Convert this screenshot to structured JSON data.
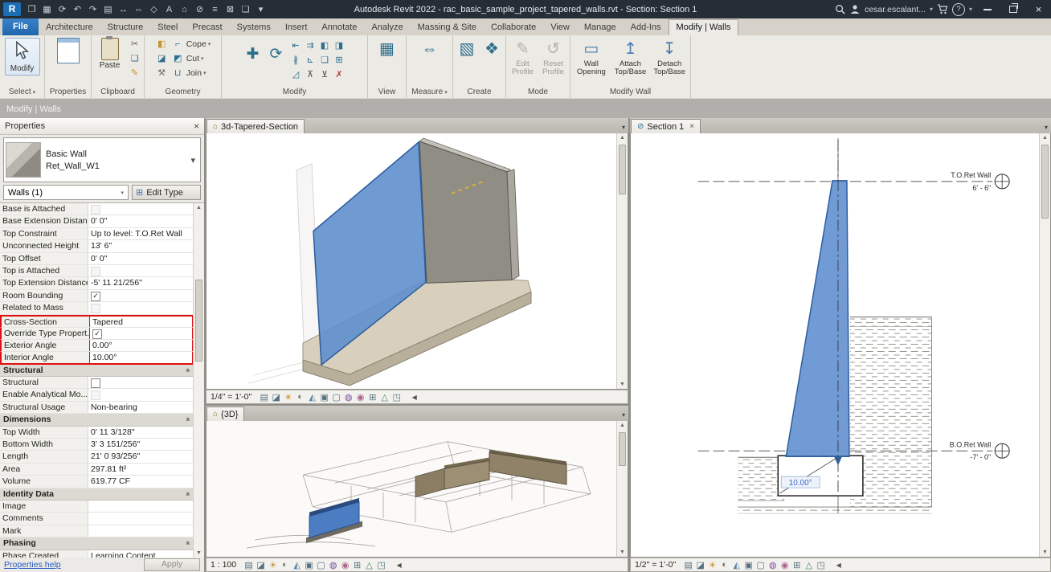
{
  "icons": {
    "chevron_down": "▾",
    "close": "×",
    "check": "✓",
    "collapse": "«",
    "scroll_up": "▲",
    "scroll_down": "▼",
    "scroll_left": "◀",
    "view3d": "⌂",
    "section_mark": "⊘",
    "edit_type": "⊞"
  },
  "titlebar": {
    "title": "Autodesk Revit 2022 - rac_basic_sample_project_tapered_walls.rvt - Section: Section 1",
    "user": "cesar.escalant...",
    "help": "?",
    "qat_icons": [
      {
        "name": "revit-logo",
        "glyph": "R",
        "logo": true
      },
      {
        "name": "open-icon",
        "glyph": "❒"
      },
      {
        "name": "save-icon",
        "glyph": "▦"
      },
      {
        "name": "sync-icon",
        "glyph": "⟳"
      },
      {
        "name": "undo-icon",
        "glyph": "↶"
      },
      {
        "name": "redo-icon",
        "glyph": "↷"
      },
      {
        "name": "print-icon",
        "glyph": "▤"
      },
      {
        "name": "measure-icon",
        "glyph": "↔"
      },
      {
        "name": "aligned-dimension-icon",
        "glyph": "⇔"
      },
      {
        "name": "tag-icon",
        "glyph": "◇"
      },
      {
        "name": "text-icon",
        "glyph": "A"
      },
      {
        "name": "default-3d-view-icon",
        "glyph": "⌂"
      },
      {
        "name": "section-icon",
        "glyph": "⊘"
      },
      {
        "name": "thin-lines-icon",
        "glyph": "≡"
      },
      {
        "name": "close-hidden-windows-icon",
        "glyph": "⊠"
      },
      {
        "name": "switch-windows-icon",
        "glyph": "❏"
      },
      {
        "name": "customize-qat-icon",
        "glyph": "▾"
      }
    ]
  },
  "ribbon": {
    "tabs": [
      {
        "label": "File",
        "file": true
      },
      {
        "label": "Architecture"
      },
      {
        "label": "Structure"
      },
      {
        "label": "Steel"
      },
      {
        "label": "Precast"
      },
      {
        "label": "Systems"
      },
      {
        "label": "Insert"
      },
      {
        "label": "Annotate"
      },
      {
        "label": "Analyze"
      },
      {
        "label": "Massing & Site"
      },
      {
        "label": "Collaborate"
      },
      {
        "label": "View"
      },
      {
        "label": "Manage"
      },
      {
        "label": "Add-Ins"
      },
      {
        "label": "Modify | Walls",
        "active": true
      }
    ],
    "panels": {
      "select": {
        "footer": "Select",
        "modify_label": "Modify"
      },
      "properties": {
        "footer": "Properties"
      },
      "clipboard": {
        "footer": "Clipboard",
        "paste_label": "Paste",
        "small": [
          {
            "name": "cut-to-clipboard-icon",
            "glyph": "✂",
            "color": "#5a5a55"
          },
          {
            "name": "copy-to-clipboard-icon",
            "glyph": "❏"
          },
          {
            "name": "match-type-properties-icon",
            "glyph": "✎",
            "color": "#c2932f"
          }
        ]
      },
      "geometry": {
        "footer": "Geometry",
        "rows": [
          {
            "name": "cope-button",
            "label": "Cope",
            "glyph": "⌐"
          },
          {
            "name": "cut-geometry-button",
            "label": "Cut",
            "glyph": "◩"
          },
          {
            "name": "join-geometry-button",
            "label": "Join",
            "glyph": "⊔"
          }
        ],
        "extra": [
          {
            "name": "paint-icon",
            "glyph": "◧",
            "color": "#c2932f"
          },
          {
            "name": "split-face-icon",
            "glyph": "◪"
          },
          {
            "name": "demolish-icon",
            "glyph": "⚒",
            "color": "#6f6c65"
          }
        ]
      },
      "modify": {
        "footer": "Modify",
        "move_glyph": "✚",
        "rotate_glyph": "⟳",
        "small": [
          {
            "name": "align-icon",
            "glyph": "⇤"
          },
          {
            "name": "offset-icon",
            "glyph": "⇉"
          },
          {
            "name": "mirror-pick-axis-icon",
            "glyph": "◧"
          },
          {
            "name": "mirror-draw-axis-icon",
            "glyph": "◨"
          },
          {
            "name": "split-element-icon",
            "glyph": "∦"
          },
          {
            "name": "trim-extend-icon",
            "glyph": "⊾"
          },
          {
            "name": "copy-icon",
            "glyph": "❏"
          },
          {
            "name": "array-icon",
            "glyph": "⊞"
          },
          {
            "name": "scale-icon",
            "glyph": "◿"
          },
          {
            "name": "pin-icon",
            "glyph": "⊼",
            "color": "#4a4a46"
          },
          {
            "name": "unpin-icon",
            "glyph": "⊻",
            "color": "#4a4a46"
          },
          {
            "name": "delete-icon",
            "glyph": "✗",
            "color": "#c0392b"
          }
        ]
      },
      "view": {
        "footer": "View",
        "glyph": "▦"
      },
      "measure": {
        "footer": "Measure",
        "glyph": "⇔"
      },
      "create": {
        "footer": "Create",
        "glyphs": [
          "▧",
          "❖"
        ]
      },
      "mode": {
        "footer": "Mode",
        "buttons": [
          {
            "label": "Edit Profile",
            "glyph": "✎"
          },
          {
            "label": "Reset Profile",
            "glyph": "↺"
          }
        ]
      },
      "modify_wall": {
        "footer": "Modify Wall",
        "buttons": [
          {
            "label": "Wall Opening",
            "glyph": "▭"
          },
          {
            "label": "Attach Top/Base",
            "glyph": "↥"
          },
          {
            "label": "Detach Top/Base",
            "glyph": "↧"
          }
        ]
      }
    }
  },
  "options_bar": {
    "label": "Modify | Walls"
  },
  "properties": {
    "title": "Properties",
    "type_name": "Basic Wall",
    "type_instance": "Ret_Wall_W1",
    "filter": "Walls (1)",
    "edit_type": "Edit Type",
    "help": "Properties help",
    "apply": "Apply",
    "rows": [
      {
        "label": "Base is Attached",
        "checkbox": true,
        "checked": false,
        "disabled": true
      },
      {
        "label": "Base Extension Distance",
        "value": "0' 0\""
      },
      {
        "label": "Top Constraint",
        "value": "Up to level: T.O.Ret Wall"
      },
      {
        "label": "Unconnected Height",
        "value": "13' 6\""
      },
      {
        "label": "Top Offset",
        "value": "0' 0\""
      },
      {
        "label": "Top is Attached",
        "checkbox": true,
        "checked": false,
        "disabled": true
      },
      {
        "label": "Top Extension Distance",
        "value": "-5' 11 21/256\""
      },
      {
        "label": "Room Bounding",
        "checkbox": true,
        "checked": true
      },
      {
        "label": "Related to Mass",
        "checkbox": true,
        "checked": false,
        "disabled": true
      },
      {
        "label": "Cross-Section",
        "value": "Tapered",
        "hl": true,
        "hl_first": true
      },
      {
        "label": "Override Type Propert...",
        "checkbox": true,
        "checked": true,
        "hl": true
      },
      {
        "label": "Exterior Angle",
        "value": "0.00°",
        "hl": true
      },
      {
        "label": "Interior Angle",
        "value": "10.00°",
        "hl": true,
        "hl_last": true
      },
      {
        "header": "Structural"
      },
      {
        "label": "Structural",
        "checkbox": true,
        "checked": false
      },
      {
        "label": "Enable Analytical Mo...",
        "checkbox": true,
        "checked": false,
        "disabled": true
      },
      {
        "label": "Structural Usage",
        "value": "Non-bearing"
      },
      {
        "header": "Dimensions"
      },
      {
        "label": "Top Width",
        "value": "0' 11 3/128\""
      },
      {
        "label": "Bottom Width",
        "value": "3' 3 151/256\""
      },
      {
        "label": "Length",
        "value": "21' 0 93/256\""
      },
      {
        "label": "Area",
        "value": "297.81 ft²"
      },
      {
        "label": "Volume",
        "value": "619.77 CF"
      },
      {
        "header": "Identity Data"
      },
      {
        "label": "Image",
        "value": ""
      },
      {
        "label": "Comments",
        "value": ""
      },
      {
        "label": "Mark",
        "value": ""
      },
      {
        "header": "Phasing"
      },
      {
        "label": "Phase Created",
        "value": "Learning Content"
      }
    ]
  },
  "views": {
    "view1": {
      "tab": "3d-Tapered-Section",
      "scale": "1/4\" = 1'-0\""
    },
    "view2": {
      "tab": "{3D}",
      "scale": "1 : 100"
    },
    "view3": {
      "tab": "Section 1",
      "scale": "1/2\" = 1'-0\"",
      "levels": [
        {
          "name": "T.O.Ret Wall",
          "elev": "6' - 6\""
        },
        {
          "name": "B.O.Ret Wall",
          "elev": "-7' - 0\""
        }
      ],
      "dimension": "10.00°"
    }
  },
  "view_control_icons": [
    {
      "name": "detail-level-icon",
      "glyph": "▤",
      "color": "#57707f"
    },
    {
      "name": "visual-style-icon",
      "glyph": "◪",
      "color": "#57707f"
    },
    {
      "name": "sun-path-icon",
      "glyph": "☀",
      "color": "#c2932f"
    },
    {
      "name": "shadows-icon",
      "glyph": "◐",
      "color": "#6f6c65"
    },
    {
      "name": "show-rendering-icon",
      "glyph": "◭",
      "color": "#5b82a8"
    },
    {
      "name": "crop-view-icon",
      "glyph": "▣",
      "color": "#57707f"
    },
    {
      "name": "show-crop-region-icon",
      "glyph": "▢",
      "color": "#57707f"
    },
    {
      "name": "temporary-hide-isolate-icon",
      "glyph": "◍",
      "color": "#7a4fa0"
    },
    {
      "name": "reveal-hidden-elements-icon",
      "glyph": "◉",
      "color": "#b0608a"
    },
    {
      "name": "temporary-view-properties-icon",
      "glyph": "⊞",
      "color": "#57707f"
    },
    {
      "name": "show-analytical-model-icon",
      "glyph": "△",
      "color": "#3f7f5f"
    },
    {
      "name": "highlight-displacement-icon",
      "glyph": "◳",
      "color": "#57707f"
    }
  ]
}
